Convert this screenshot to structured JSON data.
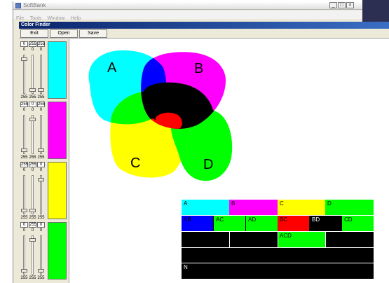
{
  "window": {
    "title": "SoftBank",
    "menu": [
      "File",
      "Tools",
      "Window",
      "Help"
    ],
    "controls": {
      "minimize": "_",
      "maximize": "□",
      "close": "×"
    }
  },
  "app": {
    "title": "Color Finder",
    "buttons": {
      "exit": "Exit",
      "open": "Open",
      "save": "Save"
    }
  },
  "channels": [
    {
      "top": [
        "0",
        "255",
        "255"
      ],
      "mid": [
        "0",
        "0",
        "0"
      ],
      "bottom": [
        "255",
        "255",
        "255"
      ],
      "color": "#00ffff"
    },
    {
      "top": [
        "255",
        "0",
        "255"
      ],
      "mid": [
        "0",
        "0",
        "0"
      ],
      "bottom": [
        "255",
        "255",
        "255"
      ],
      "color": "#ff00ff"
    },
    {
      "top": [
        "255",
        "255",
        "0"
      ],
      "mid": [
        "0",
        "0",
        "0"
      ],
      "bottom": [
        "255",
        "255",
        "255"
      ],
      "color": "#ffff00"
    },
    {
      "top": [
        "0",
        "255",
        "0"
      ],
      "mid": [
        "0",
        "0",
        "0"
      ],
      "bottom": [
        "255",
        "255",
        "255"
      ],
      "color": "#00ff00"
    }
  ],
  "canvas": {
    "labels": {
      "a": "A",
      "b": "B",
      "c": "C",
      "d": "D"
    },
    "colors": {
      "cyan": "#00ffff",
      "magenta": "#ff00ff",
      "yellow": "#ffff00",
      "green": "#00ff00",
      "blue": "#0000ff",
      "red": "#ff0000",
      "black": "#000000"
    }
  },
  "legend": {
    "row1": [
      "A",
      "B",
      "C",
      "D"
    ],
    "row2": [
      "AB",
      "AC",
      "AD",
      "BC",
      "BD",
      "CD"
    ],
    "row3": [
      "ACD"
    ],
    "row5": [
      "N"
    ]
  }
}
